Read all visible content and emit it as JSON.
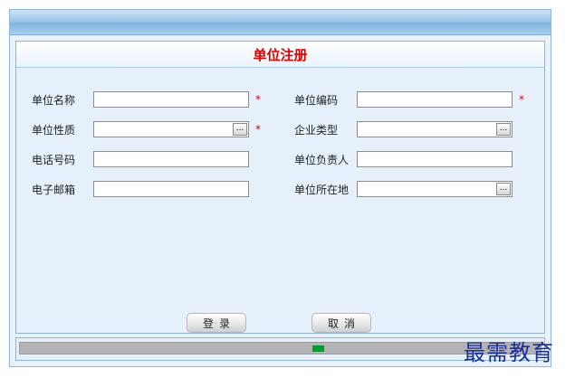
{
  "form": {
    "title": "单位注册",
    "fields": [
      {
        "label": "单位名称",
        "value": "",
        "required": true,
        "picker": false
      },
      {
        "label": "单位编码",
        "value": "",
        "required": true,
        "picker": false
      },
      {
        "label": "单位性质",
        "value": "",
        "required": true,
        "picker": true
      },
      {
        "label": "企业类型",
        "value": "",
        "required": false,
        "picker": true
      },
      {
        "label": "电话号码",
        "value": "",
        "required": false,
        "picker": false
      },
      {
        "label": "单位负责人",
        "value": "",
        "required": false,
        "picker": false
      },
      {
        "label": "电子邮箱",
        "value": "",
        "required": false,
        "picker": false
      },
      {
        "label": "单位所在地",
        "value": "",
        "required": false,
        "picker": true
      }
    ],
    "required_mark": "*",
    "picker_label": "...",
    "buttons": {
      "login": "登录",
      "cancel": "取消"
    }
  },
  "status": {
    "progress_indicator": "busy"
  },
  "watermark": "最需教育",
  "colors": {
    "title": "#e00000",
    "required": "#e00000",
    "progress_fill": "#009a2e",
    "watermark": "#1a2fa0"
  }
}
